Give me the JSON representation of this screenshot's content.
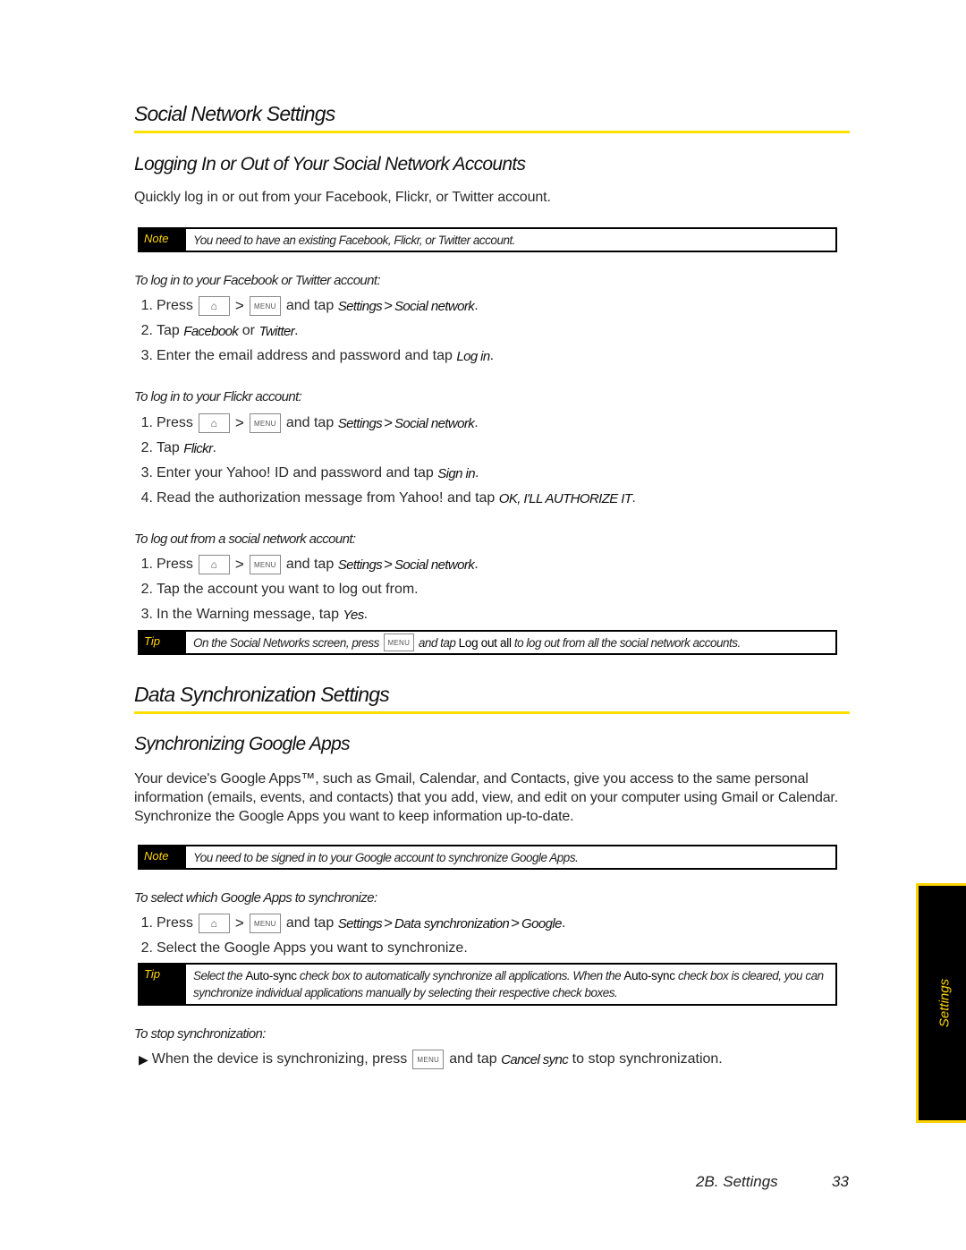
{
  "section1": {
    "title": "Social Network Settings",
    "subtitle": "Logging In or Out of Your Social Network Accounts",
    "intro": "Quickly log in or out from your Facebook, Flickr, or Twitter account.",
    "note": {
      "label": "Note",
      "text": "You need to have an existing Facebook, Flickr, or Twitter account."
    },
    "procedures": [
      {
        "heading": "To log in to your Facebook or Twitter account:",
        "steps": [
          {
            "num": "1.",
            "pre": "Press",
            "mid": "and tap",
            "path": [
              "Settings",
              "Social network"
            ],
            "end": "."
          },
          {
            "num": "2.",
            "pre": "Tap",
            "a": "Facebook",
            "or": "or",
            "b": "Twitter",
            "end": "."
          },
          {
            "num": "3.",
            "pre": "Enter the email address and password and tap",
            "em": "Log in",
            "end": "."
          }
        ]
      },
      {
        "heading": "To log in to your Flickr account:",
        "steps": [
          {
            "num": "1.",
            "pre": "Press",
            "mid": "and tap",
            "path": [
              "Settings",
              "Social network"
            ],
            "end": "."
          },
          {
            "num": "2.",
            "pre": "Tap",
            "em": "Flickr",
            "end": "."
          },
          {
            "num": "3.",
            "pre": "Enter your Yahoo! ID and password and tap",
            "em": "Sign in",
            "end": "."
          },
          {
            "num": "4.",
            "pre": "Read the authorization message from Yahoo! and tap",
            "em": "OK, I'LL AUTHORIZE IT",
            "end": "."
          }
        ]
      },
      {
        "heading": "To log out from a social network account:",
        "steps": [
          {
            "num": "1.",
            "pre": "Press",
            "mid": "and tap",
            "path": [
              "Settings",
              "Social network"
            ],
            "end": "."
          },
          {
            "num": "2.",
            "pre": "Tap the account you want to log out from."
          },
          {
            "num": "3.",
            "pre": "In the Warning message, tap",
            "em": "Yes",
            "end": "."
          }
        ]
      }
    ],
    "tip": {
      "label": "Tip",
      "pre": "On the Social Networks screen, press",
      "mid": "and tap",
      "bold": "Log out all",
      "post": "to log out from all the social network accounts."
    }
  },
  "section2": {
    "title": "Data Synchronization Settings",
    "subtitle": "Synchronizing Google Apps",
    "intro": "Your device's Google Apps™, such as Gmail, Calendar, and Contacts, give you access to the same personal information (emails, events, and contacts) that you add, view, and edit on your computer using Gmail or Calendar. Synchronize the Google Apps you want to keep information up-to-date.",
    "note": {
      "label": "Note",
      "text": "You need to be signed in to your Google account to synchronize Google Apps."
    },
    "procedure": {
      "heading": "To select which Google Apps to synchronize:",
      "steps": [
        {
          "num": "1.",
          "pre": "Press",
          "mid": "and tap",
          "path": [
            "Settings",
            "Data synchronization",
            "Google"
          ],
          "end": "."
        },
        {
          "num": "2.",
          "pre": "Select the Google Apps you want to synchronize."
        }
      ]
    },
    "tip": {
      "label": "Tip",
      "t1": "Select the",
      "b1": "Auto-sync",
      "t2": "check box to automatically synchronize all applications. When the",
      "b2": "Auto-sync",
      "t3": "check box is cleared, you can synchronize individual applications manually by selecting their respective check boxes."
    },
    "stop": {
      "heading": "To stop synchronization:",
      "pre": "When the device is synchronizing, press",
      "mid": "and tap",
      "em": "Cancel sync",
      "post": "to stop synchronization."
    }
  },
  "keys": {
    "home": "⌂",
    "menu": "MENU",
    "gt": ">"
  },
  "side_tab": {
    "label": "Settings"
  },
  "footer": {
    "chapter": "2B. Settings",
    "page": "33"
  },
  "colors": {
    "accent": "#ffe000",
    "tab_bg": "#000000",
    "label_text": "#ffd400"
  }
}
